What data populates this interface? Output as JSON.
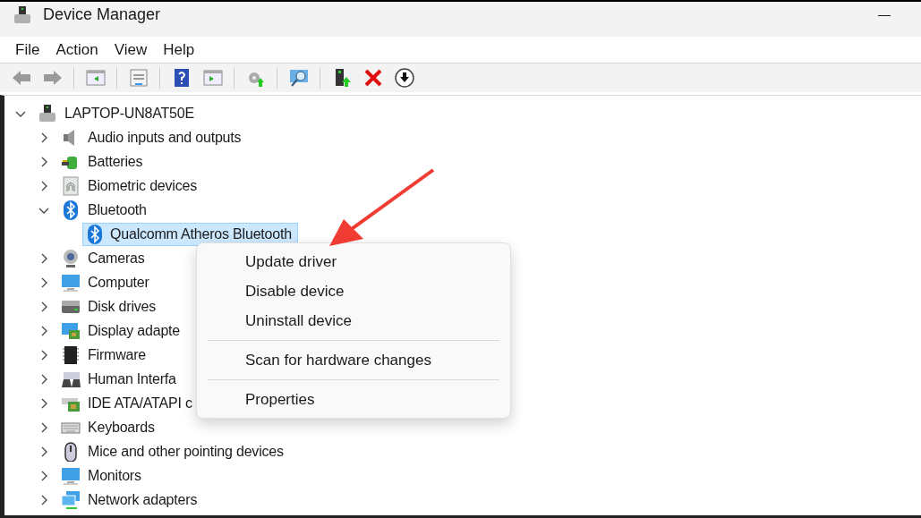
{
  "window": {
    "title": "Device Manager",
    "minimize": "—"
  },
  "menu_bar": [
    "File",
    "Action",
    "View",
    "Help"
  ],
  "tree": {
    "label": "LAPTOP-UN8AT50E",
    "expanded": true,
    "children": [
      {
        "label": "Audio inputs and outputs",
        "expanded": false,
        "selected": false
      },
      {
        "label": "Batteries",
        "expanded": false,
        "selected": false
      },
      {
        "label": "Biometric devices",
        "expanded": false,
        "selected": false
      },
      {
        "label": "Bluetooth",
        "expanded": true,
        "selected": false,
        "children": [
          {
            "label": "Qualcomm Atheros Bluetooth",
            "selected": true
          }
        ]
      },
      {
        "label": "Cameras",
        "expanded": false,
        "selected": false
      },
      {
        "label": "Computer",
        "expanded": false,
        "selected": false
      },
      {
        "label": "Disk drives",
        "expanded": false,
        "selected": false
      },
      {
        "label": "Display adapte",
        "expanded": false,
        "selected": false
      },
      {
        "label": "Firmware",
        "expanded": false,
        "selected": false
      },
      {
        "label": "Human Interfa",
        "expanded": false,
        "selected": false
      },
      {
        "label": "IDE ATA/ATAPI c",
        "expanded": false,
        "selected": false
      },
      {
        "label": "Keyboards",
        "expanded": false,
        "selected": false
      },
      {
        "label": "Mice and other pointing devices",
        "expanded": false,
        "selected": false
      },
      {
        "label": "Monitors",
        "expanded": false,
        "selected": false
      },
      {
        "label": "Network adapters",
        "expanded": false,
        "selected": false
      }
    ]
  },
  "context_menu": [
    {
      "kind": "item",
      "label": "Update driver"
    },
    {
      "kind": "item",
      "label": "Disable device"
    },
    {
      "kind": "item",
      "label": "Uninstall device"
    },
    {
      "kind": "separator"
    },
    {
      "kind": "item",
      "label": "Scan for hardware changes"
    },
    {
      "kind": "separator"
    },
    {
      "kind": "item",
      "label": "Properties"
    }
  ]
}
